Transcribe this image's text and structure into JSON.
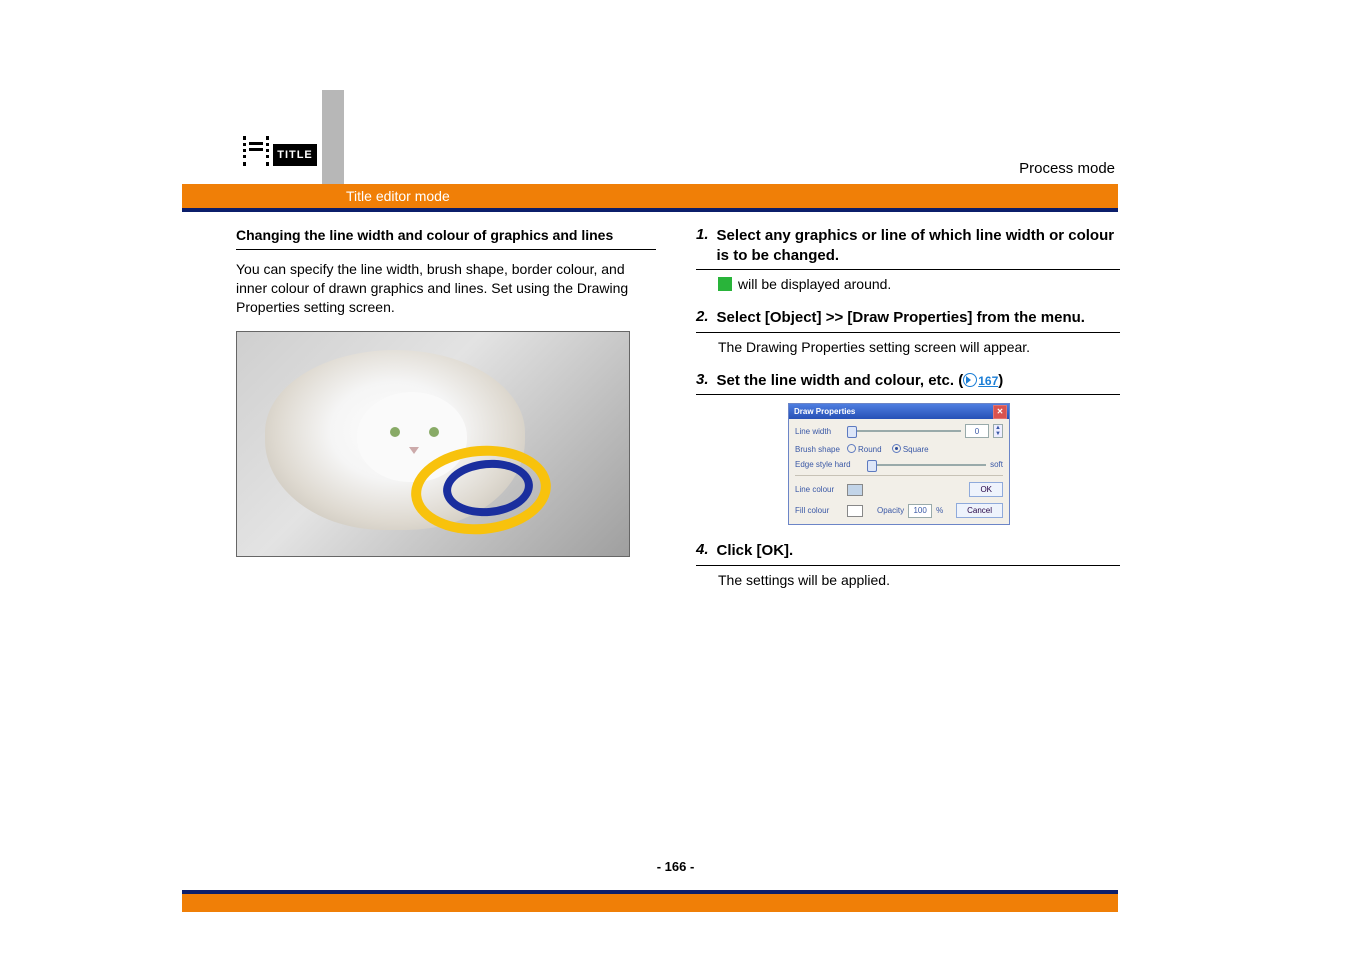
{
  "header": {
    "badge_text": "TITLE",
    "page_context": "Process mode",
    "mode_label": "Title editor mode"
  },
  "left": {
    "subtitle": "Changing the line width and colour of graphics and lines",
    "paragraph": "You can specify the line width, brush shape, border colour, and inner colour of drawn graphics and lines. Set using the Drawing Properties setting screen."
  },
  "right": {
    "steps": [
      {
        "num": "1.",
        "title": "Select any graphics or line of which line width or colour is to be changed.",
        "body_after_square": "will be displayed around."
      },
      {
        "num": "2.",
        "title": "Select [Object] >> [Draw Properties] from the menu.",
        "body": "The Drawing Properties setting screen will appear."
      },
      {
        "num": "3.",
        "title_prefix": "Set the line width and colour, etc. (",
        "link_text": "167",
        "title_suffix": ")"
      },
      {
        "num": "4.",
        "title": "Click [OK].",
        "body": "The settings will be applied."
      }
    ]
  },
  "dialog": {
    "title": "Draw Properties",
    "line_width_label": "Line width",
    "line_width_value": "0",
    "brush_shape_label": "Brush shape",
    "brush_round": "Round",
    "brush_square": "Square",
    "edge_label": "Edge style hard",
    "edge_right": "soft",
    "line_colour_label": "Line colour",
    "ok": "OK",
    "fill_colour_label": "Fill colour",
    "opacity_label": "Opacity",
    "opacity_value": "100",
    "percent": "%",
    "cancel": "Cancel"
  },
  "footer": {
    "page_number": "- 166 -"
  }
}
